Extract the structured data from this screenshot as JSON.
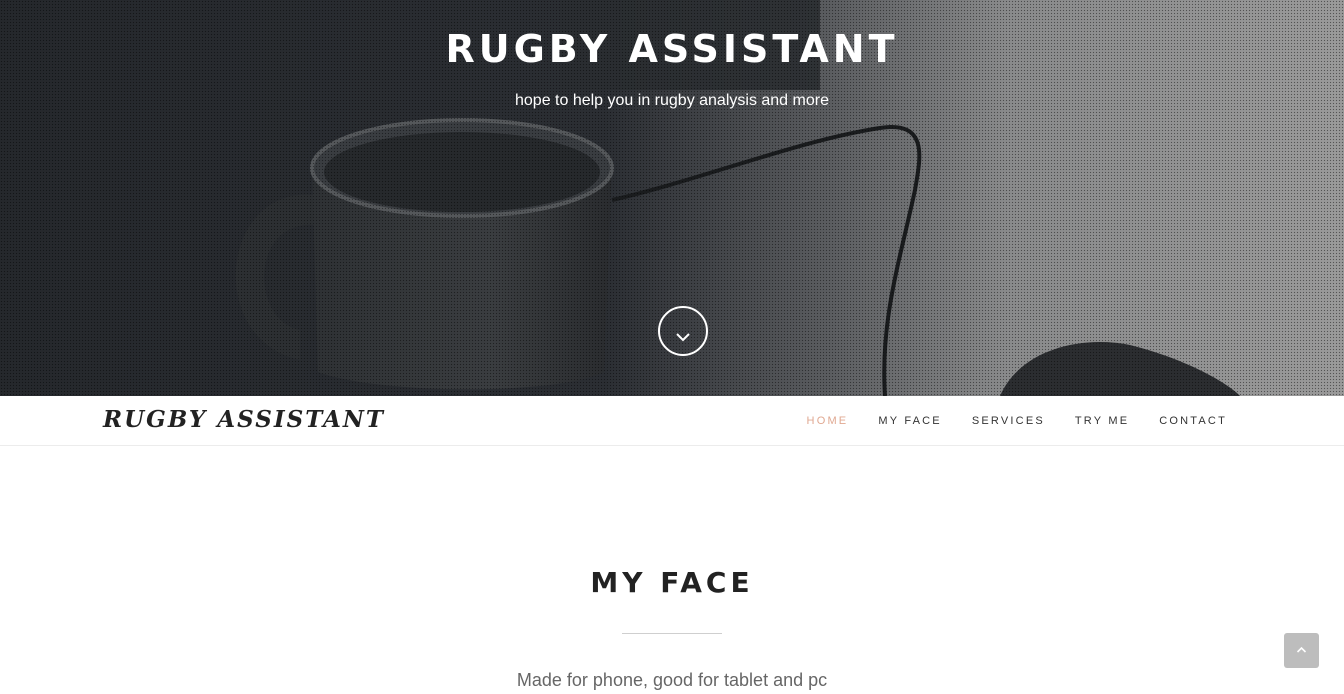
{
  "hero": {
    "title": "RUGBY ASSISTANT",
    "subtitle": "hope to help you in rugby analysis and more",
    "scroll_icon": "chevron-down-icon"
  },
  "navbar": {
    "brand": "RUGBY ASSISTANT",
    "items": [
      {
        "label": "HOME",
        "active": true
      },
      {
        "label": "MY FACE",
        "active": false
      },
      {
        "label": "SERVICES",
        "active": false
      },
      {
        "label": "TRY ME",
        "active": false
      },
      {
        "label": "CONTACT",
        "active": false
      }
    ]
  },
  "section": {
    "title": "MY FACE",
    "text": "Made for phone, good for tablet and pc"
  },
  "back_to_top": {
    "icon": "chevron-up-icon"
  },
  "colors": {
    "accent": "#e0a891",
    "text_dark": "#222222",
    "text_muted": "#666666",
    "back_to_top_bg": "#bdbdbd"
  }
}
